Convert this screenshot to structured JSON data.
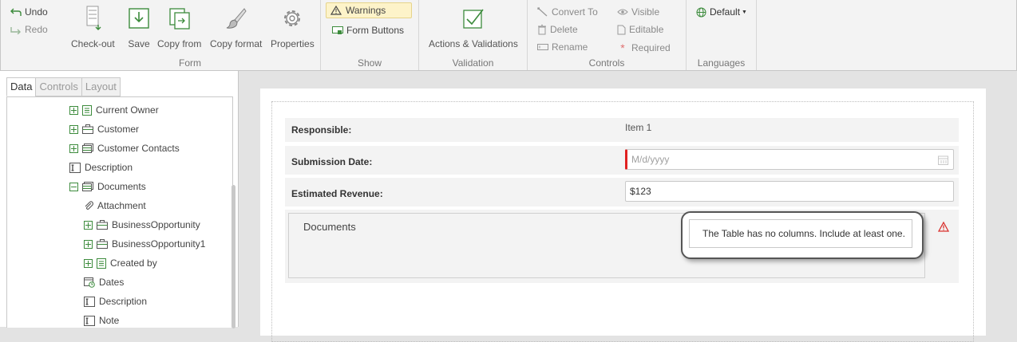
{
  "ribbon": {
    "undo": "Undo",
    "redo": "Redo",
    "form_group": {
      "label": "Form",
      "checkout": "Check-out",
      "save": "Save",
      "copy_from": "Copy from",
      "copy_format": "Copy format",
      "properties": "Properties"
    },
    "show_group": {
      "label": "Show",
      "warnings": "Warnings",
      "form_buttons": "Form Buttons"
    },
    "validation_group": {
      "label": "Validation",
      "actions": "Actions & Validations"
    },
    "controls_group": {
      "label": "Controls",
      "convert_to": "Convert To",
      "delete": "Delete",
      "rename": "Rename",
      "visible": "Visible",
      "editable": "Editable",
      "required": "Required"
    },
    "languages_group": {
      "label": "Languages",
      "default": "Default"
    }
  },
  "left_panel": {
    "tabs": [
      "Data",
      "Controls",
      "Layout"
    ],
    "active_tab": "Data",
    "tree": [
      {
        "label": "Current Owner",
        "icon": "list-icon",
        "expander": "plus"
      },
      {
        "label": "Customer",
        "icon": "briefcase-icon",
        "expander": "plus"
      },
      {
        "label": "Customer Contacts",
        "icon": "table-icon",
        "expander": "plus"
      },
      {
        "label": "Description",
        "icon": "text-field-icon",
        "expander": "none"
      },
      {
        "label": "Documents",
        "icon": "table-icon",
        "expander": "minus"
      },
      {
        "label": "Attachment",
        "icon": "paperclip-icon",
        "expander": "none"
      },
      {
        "label": "BusinessOpportunity",
        "icon": "briefcase-icon",
        "expander": "plus"
      },
      {
        "label": "BusinessOpportunity1",
        "icon": "briefcase-icon",
        "expander": "plus"
      },
      {
        "label": "Created by",
        "icon": "list-icon",
        "expander": "plus"
      },
      {
        "label": "Dates",
        "icon": "calendar-icon",
        "expander": "none"
      },
      {
        "label": "Description",
        "icon": "text-field-icon",
        "expander": "none"
      },
      {
        "label": "Note",
        "icon": "text-field-icon",
        "expander": "none"
      }
    ]
  },
  "form": {
    "responsible": {
      "label": "Responsible:",
      "value": "Item 1"
    },
    "submission_date": {
      "label": "Submission Date:",
      "placeholder": "M/d/yyyy"
    },
    "estimated_revenue": {
      "label": "Estimated Revenue:",
      "value": "$123"
    },
    "documents": {
      "title": "Documents"
    },
    "tooltip": "The Table has no columns. Include at least one."
  },
  "colors": {
    "warning_bg": "#fdf3c9",
    "required_bar": "#e02020",
    "warning_icon": "#d9302c",
    "icon_green": "#3c8b3c"
  }
}
